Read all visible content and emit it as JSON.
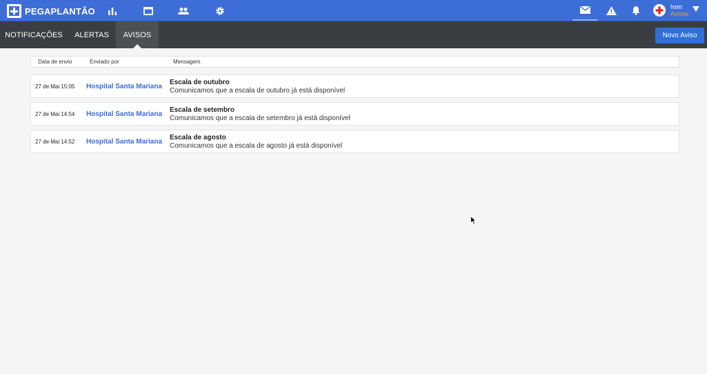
{
  "app": {
    "name": "PEGAPLANTÃO"
  },
  "topnav": {
    "icons": [
      "bar-chart-icon",
      "window-icon",
      "people-icon",
      "gear-icon"
    ],
    "right_icons": [
      "mail-icon",
      "warning-icon",
      "bell-icon"
    ]
  },
  "user": {
    "name": "hsm",
    "role": "Avisos"
  },
  "tabs": [
    {
      "label": "NOTIFICAÇÕES",
      "active": false
    },
    {
      "label": "ALERTAS",
      "active": false
    },
    {
      "label": "AVISOS",
      "active": true
    }
  ],
  "actions": {
    "new_label": "Novo Aviso"
  },
  "table": {
    "headers": {
      "date": "Data de envio",
      "from": "Enviado por",
      "message": "Mensagem"
    },
    "rows": [
      {
        "date": "27 de Mai 15:05",
        "from": "Hospital Santa Mariana",
        "title": "Escala de outubro",
        "message": "Comunicamos que a escala de outubro já está disponível"
      },
      {
        "date": "27 de Mai 14:54",
        "from": "Hospital Santa Mariana",
        "title": "Escala de setembro",
        "message": "Comunicamos que a escala de setembro já está disponível"
      },
      {
        "date": "27 de Mai 14:52",
        "from": "Hospital Santa Mariana",
        "title": "Escala de agosto",
        "message": "Comunicamos que a escala de agosto já está disponível"
      }
    ]
  },
  "colors": {
    "brand": "#3d6dd6",
    "tabbar": "#3a3d41",
    "button": "#2f6fd8",
    "role": "#f0a030"
  }
}
